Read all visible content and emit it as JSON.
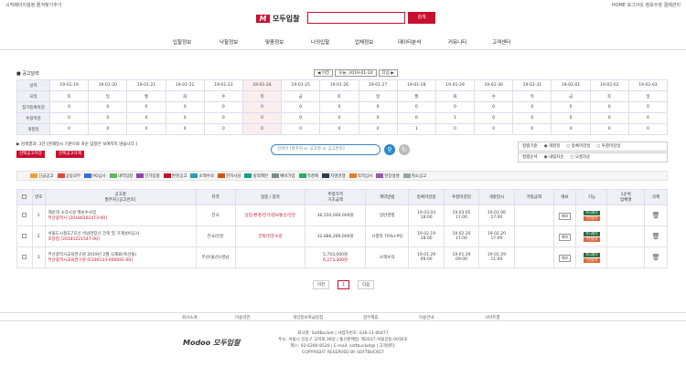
{
  "topbar": {
    "left": "시작페이지설정  즐겨찾기추가",
    "right": "HOME  로그아웃  정보수정  결제관리"
  },
  "header": {
    "logo_text": "모두입찰",
    "logo_mark": "M",
    "search_button": "검색"
  },
  "nav": [
    "입찰정보",
    "낙찰정보",
    "맞춤정보",
    "나의입찰",
    "업체정보",
    "데이터분석",
    "커뮤니티",
    "고객센터"
  ],
  "calendar": {
    "title": "■ 공고달력",
    "prev": "◀ 이전",
    "today_label": "오늘: 2019-01-24",
    "next": "다음 ▶",
    "rows": [
      {
        "head": "날자",
        "cells": [
          "19-01-19",
          "19-01-20",
          "19-01-21",
          "19-01-22",
          "19-01-23",
          "19-01-24",
          "19-01-25",
          "19-01-26",
          "19-01-27",
          "19-01-28",
          "19-01-29",
          "19-01-30",
          "19-01-31",
          "19-02-01",
          "19-02-02",
          "19-02-03"
        ]
      },
      {
        "head": "요일",
        "cells": [
          "토",
          "일",
          "월",
          "화",
          "수",
          "목",
          "금",
          "토",
          "일",
          "월",
          "화",
          "수",
          "목",
          "금",
          "토",
          "일"
        ]
      },
      {
        "head": "참가등록마감",
        "cells": [
          "0",
          "0",
          "0",
          "0",
          "0",
          "0",
          "0",
          "0",
          "0",
          "0",
          "0",
          "0",
          "0",
          "0",
          "0",
          "0"
        ]
      },
      {
        "head": "투찰마감",
        "cells": [
          "0",
          "0",
          "0",
          "0",
          "0",
          "0",
          "0",
          "0",
          "0",
          "0",
          "1",
          "0",
          "0",
          "0",
          "0",
          "0"
        ]
      },
      {
        "head": "개찰일",
        "cells": [
          "0",
          "0",
          "0",
          "0",
          "0",
          "0",
          "0",
          "0",
          "0",
          "1",
          "0",
          "0",
          "0",
          "0",
          "0",
          "0"
        ]
      }
    ]
  },
  "filter": {
    "result_text": "▶ 검색결과: 3건 [현재일시 기준으로 차순 입찰은 보여지지 않습니다.]",
    "btn_select": "선택공고저장",
    "btn_all": "선택공고삭제",
    "search_placeholder": "검색어 [발주처 or 공고명 or 공고번호]",
    "sort_label": "정렬기준",
    "sort_options": [
      "◉ 개찰일",
      "○ 등록마감일",
      "○ 투찰마감일"
    ],
    "order_label": "정렬순서",
    "order_options": [
      "◉ 내림차순",
      "○ 오름차순"
    ]
  },
  "legend": [
    {
      "label": "긴급공고",
      "color": "#f0a030"
    },
    {
      "label": "공동의무",
      "color": "#e0463a"
    },
    {
      "label": "PQ심사",
      "color": "#3a6fd0"
    },
    {
      "label": "내역입찰",
      "color": "#5cb85c"
    },
    {
      "label": "단가입찰",
      "color": "#8e44ad"
    },
    {
      "label": "변경공고",
      "color": "#c8102e"
    },
    {
      "label": "소액수의",
      "color": "#2aa0b4"
    },
    {
      "label": "전자시담",
      "color": "#d35400"
    },
    {
      "label": "실적제한",
      "color": "#16a085"
    },
    {
      "label": "예비가입",
      "color": "#7f8c8d"
    },
    {
      "label": "역경매",
      "color": "#27ae60"
    },
    {
      "label": "지명경쟁",
      "color": "#2c3e50"
    },
    {
      "label": "적격심사",
      "color": "#e67e22"
    },
    {
      "label": "현장설명",
      "color": "#9b59b6"
    },
    {
      "label": "취소공고",
      "color": "#95a5a6"
    }
  ],
  "table": {
    "headers": [
      "번호",
      "공고명\n발주처 [공고번호]",
      "지역",
      "업종 / 종목",
      "추정가격\n기초금액",
      "계약방법",
      "등록마감일",
      "투찰마감일",
      "개찰일시",
      "가정금액",
      "예보",
      "기능",
      "1순위\n업체명",
      "삭제"
    ],
    "rows": [
      {
        "no": "1",
        "title": "해운대 소각시설 매보수사업",
        "org": "부산광역시 [20180202473-00]",
        "region": "전국",
        "biz": "상업·환경/전기/정보통신/전문",
        "price": "36,550,000,000원",
        "price2": "",
        "method": "일반경쟁",
        "reg": "19.03.04\n18:00",
        "bid": "19.03.05\n17:00",
        "open": "19.03.06\n17:00",
        "exp": "",
        "yebo": "예보",
        "f1": "투시예가",
        "f2": "구간분석",
        "winner": ""
      },
      {
        "no": "2",
        "title": "서울도시철도7호선 석남연장선 건축 및 기계설비공사",
        "org": "조달청 [20181221547-00]",
        "region": "전국/인천",
        "biz": "건축/전문소방",
        "price": "32,886,269,000원",
        "price2": "",
        "method": "시행적 70%+PQ",
        "reg": "19.02.19\n18:00",
        "bid": "19.02.20\n17:00",
        "open": "19.02.20\n17:00",
        "exp": "",
        "yebo": "예보",
        "f1": "투시예가",
        "f2": "구간분석",
        "winner": ""
      },
      {
        "no": "3",
        "title": "부산광역시교육연구원 2019년 2월 식재료(축산물)",
        "org": "부산광역시교육연구원 [E190123-000091-00]",
        "region": "부산(울산)/경남",
        "biz": "",
        "price": "5,703,000원",
        "price2": "6,273,300원",
        "method": "소액수의",
        "reg": "19.01.29\n09:00",
        "bid": "19.01.29\n09:00",
        "open": "19.01.29\n11:00",
        "exp": "",
        "yebo": "예보",
        "f1": "투시예가",
        "f2": "구간분석",
        "winner": ""
      }
    ]
  },
  "pager": {
    "prev": "이전",
    "current": "1",
    "next": "다음"
  },
  "footer": {
    "nav": [
      "회사소개",
      "이용약관",
      "개인정보취급방침",
      "업무제휴",
      "이용안내",
      "사이트맵"
    ],
    "logo": "Modoo 모두입찰",
    "lines": [
      "회사명: SoftBucket | 사업자번호: 636-11-00477",
      "주소: 서울시 강동구 고덕로 39길 | 통신판매업: 제2017-서울강동-0016호",
      "팩스: 02-6280-8520 | E-mail: softbucket@ | 고객센터:",
      "COPYRIGHT RESERVED BY SOFTBUCKET"
    ]
  }
}
